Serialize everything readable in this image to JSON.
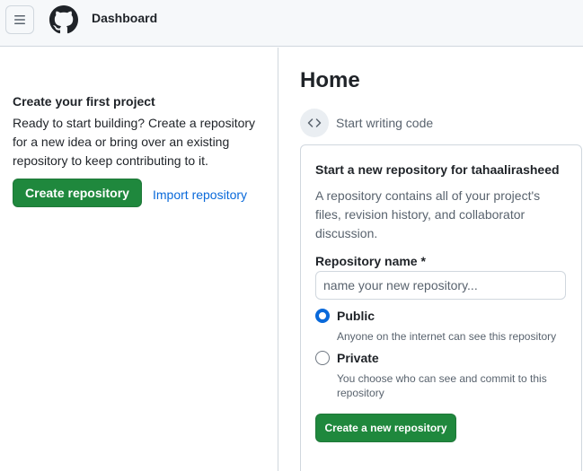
{
  "header": {
    "title": "Dashboard",
    "menu_icon": "hamburger-icon",
    "logo_icon": "github-logo-icon"
  },
  "left": {
    "title": "Create your first project",
    "description": "Ready to start building? Create a repository for a new idea or bring over an existing repository to keep contributing to it.",
    "create_button": "Create repository",
    "import_link": "Import repository"
  },
  "main": {
    "title": "Home",
    "start_writing": "Start writing code",
    "code_icon": "code-icon"
  },
  "card": {
    "title": "Start a new repository for tahaalirasheed",
    "description": "A repository contains all of your project's files, revision history, and collaborator discussion.",
    "name_label": "Repository name *",
    "name_placeholder": "name your new repository...",
    "name_value": "",
    "visibility_options": [
      {
        "label": "Public",
        "help": "Anyone on the internet can see this repository",
        "checked": true
      },
      {
        "label": "Private",
        "help": "You choose who can see and commit to this repository",
        "checked": false
      }
    ],
    "submit_button": "Create a new repository"
  },
  "colors": {
    "primary_green": "#1f883d",
    "link_blue": "#0969da",
    "border": "#d0d7de",
    "header_bg": "#f6f8fa"
  }
}
